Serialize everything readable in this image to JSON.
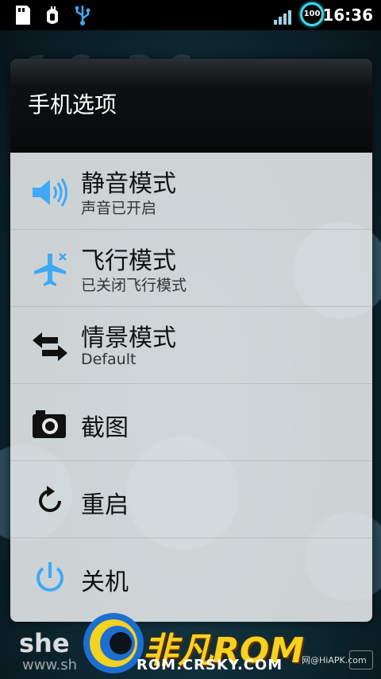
{
  "status_bar": {
    "time": "16:36",
    "battery_level": "100",
    "icons": [
      "sd-card-icon",
      "usb-debug-icon",
      "usb-icon",
      "signal-icon"
    ]
  },
  "background": {
    "clock": "16:36"
  },
  "dialog": {
    "title": "手机选项",
    "items": [
      {
        "label": "静音模式",
        "sublabel": "声音已开启",
        "icon": "volume-icon"
      },
      {
        "label": "飞行模式",
        "sublabel": "已关闭飞行模式",
        "icon": "airplane-icon"
      },
      {
        "label": "情景模式",
        "sublabel": "Default",
        "icon": "profile-swap-icon"
      },
      {
        "label": "截图",
        "icon": "camera-icon"
      },
      {
        "label": "重启",
        "icon": "reboot-icon"
      },
      {
        "label": "关机",
        "icon": "power-icon"
      }
    ]
  },
  "watermark": {
    "brand": "非凡ROM",
    "url": "ROM.CRSKY.COM",
    "shell": "she",
    "shell_url": "www.sh",
    "hiapk": "网@HiAPK.com"
  },
  "colors": {
    "accent": "#3fa9f5",
    "battery_ring": "#3fd6e8",
    "list_bg": "#e8eaec"
  }
}
